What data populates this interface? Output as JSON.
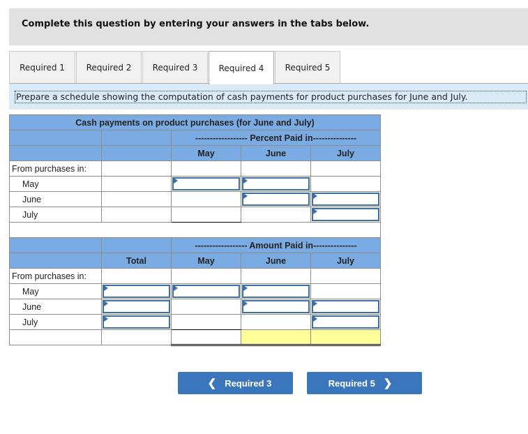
{
  "banner": {
    "text": "Complete this question by entering your answers in the tabs below."
  },
  "tabs": [
    {
      "label": "Required 1",
      "active": false
    },
    {
      "label": "Required 2",
      "active": false
    },
    {
      "label": "Required 3",
      "active": false
    },
    {
      "label": "Required 4",
      "active": true
    },
    {
      "label": "Required 5",
      "active": false
    }
  ],
  "instruction": "Prepare a schedule showing the computation of cash payments for product purchases for June and July.",
  "schedule": {
    "title": "Cash payments on product purchases (for June and July)",
    "percent_section": {
      "group_header": "------------------ Percent Paid in---------------",
      "columns": [
        "May",
        "June",
        "July"
      ],
      "from_label": "From purchases in:",
      "rows": [
        {
          "label": "May",
          "inputs": [
            "May",
            "June"
          ]
        },
        {
          "label": "June",
          "inputs": [
            "June",
            "July"
          ]
        },
        {
          "label": "July",
          "inputs": [
            "July"
          ]
        }
      ]
    },
    "amount_section": {
      "group_header": "------------------ Amount Paid in---------------",
      "columns": [
        "Total",
        "May",
        "June",
        "July"
      ],
      "from_label": "From purchases in:",
      "rows": [
        {
          "label": "May",
          "inputs": [
            "Total",
            "May",
            "June"
          ]
        },
        {
          "label": "June",
          "inputs": [
            "Total",
            "June",
            "July"
          ]
        },
        {
          "label": "July",
          "inputs": [
            "Total",
            "July"
          ]
        }
      ]
    }
  },
  "nav": {
    "prev_label": "Required 3",
    "next_label": "Required 5",
    "prev_icon": "chevron-left-icon",
    "next_icon": "chevron-right-icon"
  },
  "colors": {
    "header_blue": "#7aace3",
    "button_blue": "#3b76bc",
    "total_yellow": "#ffff99"
  }
}
